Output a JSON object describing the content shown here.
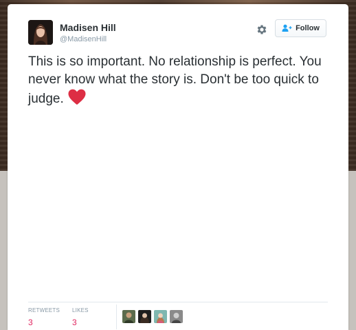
{
  "tweet": {
    "author_name": "Madisen Hill",
    "author_handle": "@MadisenHill",
    "avatar_icon": "profile-photo-avatar",
    "settings_icon": "gear-icon",
    "follow_label": "Follow",
    "follow_icon": "add-user-icon",
    "accent_color": "#1da1f2",
    "text": "This is so important. No relationship is perfect. You never know what the story is. Don't be too quick to judge.",
    "emoji": "red-heart-icon",
    "emoji_color": "#dd2e44"
  },
  "stats": {
    "retweets_label": "RETWEETS",
    "retweets_count": "3",
    "likes_label": "LIKES",
    "likes_count": "3",
    "value_color": "#e0245e"
  },
  "likers": [
    {
      "icon": "liker-avatar-1"
    },
    {
      "icon": "liker-avatar-2"
    },
    {
      "icon": "liker-avatar-3"
    },
    {
      "icon": "liker-avatar-4"
    }
  ]
}
